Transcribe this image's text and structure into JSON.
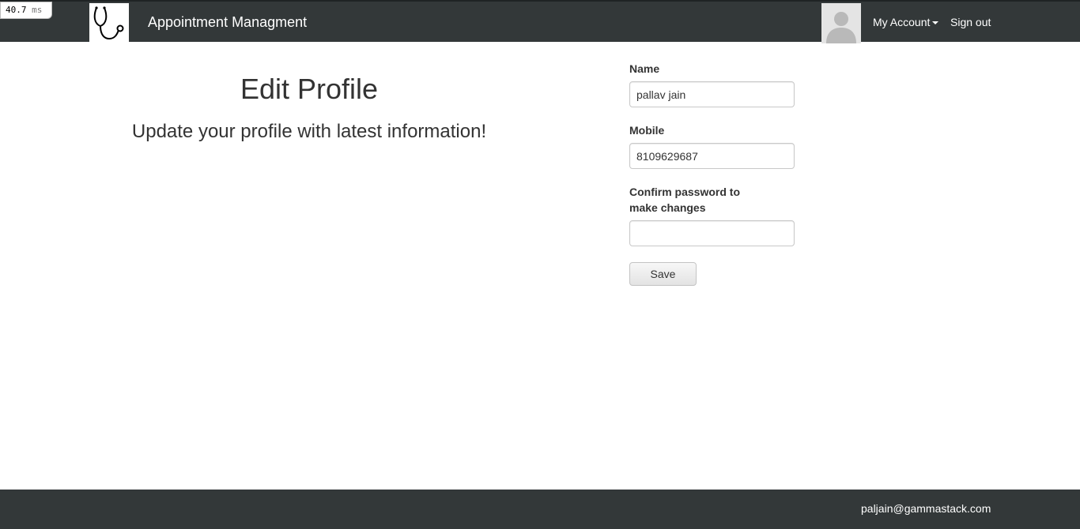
{
  "perf": {
    "value": "40.7",
    "unit": "ms"
  },
  "navbar": {
    "brand": "Appointment Managment",
    "my_account": "My Account",
    "sign_out": "Sign out",
    "logo_icon": "stethoscope-icon",
    "avatar_icon": "user-avatar-icon"
  },
  "main": {
    "title": "Edit Profile",
    "subtitle": "Update your profile with latest information!"
  },
  "form": {
    "name_label": "Name",
    "name_value": "pallav jain",
    "mobile_label": "Mobile",
    "mobile_value": "8109629687",
    "password_label_line1": "Confirm password to",
    "password_label_line2": "make changes",
    "password_value": "",
    "save_label": "Save"
  },
  "footer": {
    "email": "paljain@gammastack.com"
  },
  "colors": {
    "navbar_bg": "#333839",
    "footer_bg": "#333839",
    "text": "#333333"
  }
}
